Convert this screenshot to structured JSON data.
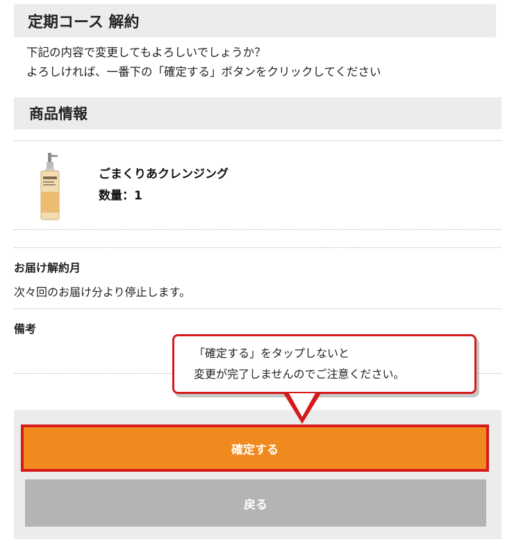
{
  "page": {
    "title": "定期コース 解約",
    "intro_line1": "下記の内容で変更してもよろしいでしょうか？",
    "intro_line2": "よろしければ、一番下の「確定する」ボタンをクリックしてください"
  },
  "product_section": {
    "header": "商品情報",
    "product": {
      "name": "ごまくりあクレンジング",
      "quantity": "数量：1",
      "image_icon": "cleansing-oil-bottle"
    }
  },
  "delivery_cancel": {
    "label": "お届け解約月",
    "value": "次々回のお届け分より停止します。"
  },
  "notes": {
    "label": "備考",
    "value": ""
  },
  "callout": {
    "line1": "「確定する」をタップしないと",
    "line2": "変更が完了しませんのでご注意ください。"
  },
  "actions": {
    "confirm_label": "確定する",
    "back_label": "戻る"
  },
  "colors": {
    "accent_orange": "#f08a1e",
    "highlight_red": "#d51a1a",
    "panel_gray": "#ececec",
    "back_button_gray": "#b4b4b4"
  }
}
